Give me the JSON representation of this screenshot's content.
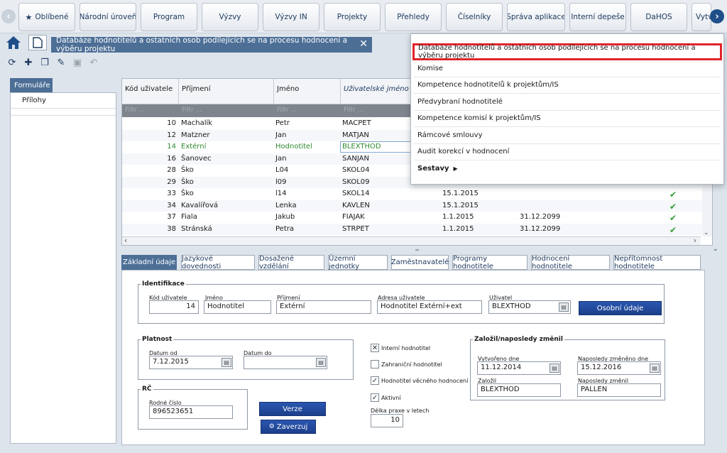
{
  "nav": {
    "tabs": [
      "Oblíbené",
      "Národní úroveň",
      "Program",
      "Výzvy",
      "Výzvy IN",
      "Projekty",
      "Přehledy",
      "Číselníky",
      "Správa aplikace",
      "Interní depeše",
      "DaHOS",
      "Vytv"
    ]
  },
  "page_tab": {
    "title": "Databáze hodnotitelů a ostatních osob podílejících se na procesu hodnocení a výběru projektu",
    "close": "✕"
  },
  "left": {
    "tab": "Formuláře",
    "items": [
      "Přílohy"
    ]
  },
  "grid": {
    "headers": [
      "Kód uživatele",
      "Příjmení",
      "Jméno",
      "Uživatelské jméno"
    ],
    "filter_placeholder": "Filtr ...",
    "rows": [
      {
        "kod": "10",
        "prijmeni": "Machalík",
        "jmeno": "Petr",
        "user": "MACPET",
        "od": "",
        "do": "",
        "check": ""
      },
      {
        "kod": "12",
        "prijmeni": "Matzner",
        "jmeno": "Jan",
        "user": "MATJAN",
        "od": "",
        "do": "",
        "check": ""
      },
      {
        "kod": "14",
        "prijmeni": "Extérní",
        "jmeno": "Hodnotitel",
        "user": "BLEXTHOD",
        "od": "",
        "do": "",
        "check": ""
      },
      {
        "kod": "16",
        "prijmeni": "Šanovec",
        "jmeno": "Jan",
        "user": "SANJAN",
        "od": "",
        "do": "",
        "check": ""
      },
      {
        "kod": "28",
        "prijmeni": "Ško",
        "jmeno": "L04",
        "user": "SKOL04",
        "od": "",
        "do": "",
        "check": ""
      },
      {
        "kod": "29",
        "prijmeni": "Ško",
        "jmeno": "l09",
        "user": "SKOL09",
        "od": "",
        "do": "",
        "check": ""
      },
      {
        "kod": "33",
        "prijmeni": "Ško",
        "jmeno": "l14",
        "user": "SKOL14",
        "od": "15.1.2015",
        "do": "",
        "check": "✔"
      },
      {
        "kod": "34",
        "prijmeni": "Kavalířová",
        "jmeno": "Lenka",
        "user": "KAVLEN",
        "od": "15.1.2015",
        "do": "",
        "check": "✔"
      },
      {
        "kod": "37",
        "prijmeni": "Fiala",
        "jmeno": "Jakub",
        "user": "FIAJAK",
        "od": "1.1.2015",
        "do": "31.12.2099",
        "check": "✔"
      },
      {
        "kod": "38",
        "prijmeni": "Stránská",
        "jmeno": "Petra",
        "user": "STRPET",
        "od": "1.1.2015",
        "do": "31.12.2099",
        "check": "✔"
      }
    ]
  },
  "dropdown": {
    "items": [
      "Databáze hodnotitelů a ostatních osob podílejících se na procesu hodnocení a výběru projektu",
      "Komise",
      "Kompetence hodnotitelů k projektům/IS",
      "Předvybraní hodnotitelé",
      "Kompetence komisí k projektům/IS",
      "Rámcové smlouvy",
      "Audit korekcí v hodnocení",
      "Sestavy"
    ]
  },
  "bottom_tabs": [
    "Základní údaje",
    "Jazykové dovednosti",
    "Dosažené vzdělání",
    "Územní jednotky",
    "Zaměstnavatelé",
    "Programy hodnotitele",
    "Hodnocení hodnotitele",
    "Nepřítomnost hodnotitele"
  ],
  "form": {
    "ident": {
      "title": "Identifikace",
      "kod_label": "Kód uživatele",
      "kod": "14",
      "jmeno_label": "Jméno",
      "jmeno": "Hodnotitel",
      "prijmeni_label": "Příjmení",
      "prijmeni": "Extérní",
      "adresa_label": "Adresa uživatele",
      "adresa": "Hodnotitel Extérní+ext",
      "uzivatel_label": "Uživatel",
      "uzivatel": "BLEXTHOD",
      "osobni_btn": "Osobní údaje"
    },
    "platnost": {
      "title": "Platnost",
      "od_label": "Datum od",
      "od": "7.12.2015",
      "do_label": "Datum do",
      "do": ""
    },
    "rc": {
      "title": "RČ",
      "label": "Rodné číslo",
      "value": "896523651"
    },
    "verze_btn": "Verze",
    "zaverzuj_btn": "Zaverzuj",
    "checks": {
      "interni": "Interní hodnotitel",
      "zahranicni": "Zahraniční hodnotitel",
      "vecny": "Hodnotitel věcného hodnocení",
      "aktivni": "Aktivní",
      "delka_label": "Délka praxe v letech",
      "delka": "10"
    },
    "zalozil": {
      "title": "Založil/naposledy změnil",
      "vytvoreno_label": "Vytvořeno dne",
      "vytvoreno": "11.12.2014",
      "zmeneno_label": "Naposledy změněno dne",
      "zmeneno": "15.12.2016",
      "zalozil_label": "Založil",
      "zalozil": "BLEXTHOD",
      "zmenil_label": "Naposledy změnil",
      "zmenil": "PALLEN"
    }
  },
  "colors": {
    "accent": "#4d6f96",
    "highlight": "#2e8b2e",
    "red_outline": "#e0242b"
  }
}
